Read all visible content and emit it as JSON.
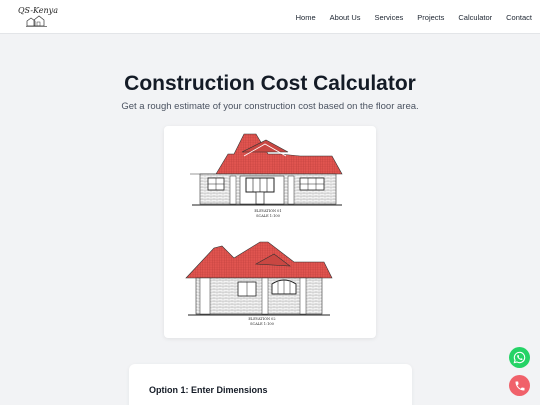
{
  "brand": {
    "name": "QS-Kenya"
  },
  "nav": {
    "items": [
      {
        "label": "Home"
      },
      {
        "label": "About Us"
      },
      {
        "label": "Services"
      },
      {
        "label": "Projects"
      },
      {
        "label": "Calculator"
      },
      {
        "label": "Contact"
      }
    ]
  },
  "hero": {
    "title": "Construction Cost Calculator",
    "subtitle": "Get a rough estimate of your construction cost based on the floor area."
  },
  "plan": {
    "front": {
      "title": "ELEVATION 01",
      "scale": "SCALE 1:100"
    },
    "side": {
      "title": "ELEVATION 02",
      "scale": "SCALE 1:100"
    }
  },
  "option1": {
    "title": "Option 1: Enter Dimensions"
  },
  "floating": {
    "whatsapp_icon": "whatsapp-icon",
    "phone_icon": "phone-icon"
  },
  "colors": {
    "roof": "#e0524f",
    "whatsapp": "#25d366",
    "call": "#f0616a",
    "background": "#f2f3f5"
  }
}
